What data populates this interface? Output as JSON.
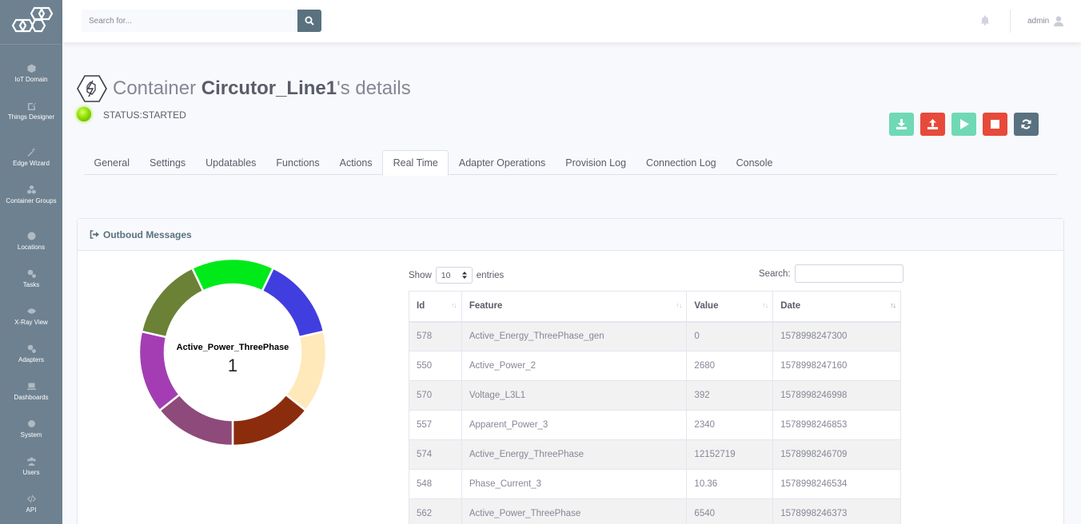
{
  "sidebar": {
    "logo_icon": "hexagon-logo-icon",
    "items": [
      {
        "label": "IoT Domain",
        "icon": "cube-icon"
      },
      {
        "label": "Things Designer",
        "icon": "edit-icon"
      },
      {
        "label": "Edge Wizard",
        "icon": "wand-icon"
      },
      {
        "label": "Container Groups",
        "icon": "cubes-icon"
      },
      {
        "label": "Locations",
        "icon": "globe-icon"
      },
      {
        "label": "Tasks",
        "icon": "cogs-icon"
      },
      {
        "label": "X-Ray View",
        "icon": "eye-icon"
      },
      {
        "label": "Adapters",
        "icon": "cogs-icon"
      },
      {
        "label": "Dashboards",
        "icon": "laptop-icon"
      },
      {
        "label": "System",
        "icon": "gear-icon"
      },
      {
        "label": "Users",
        "icon": "users-icon"
      },
      {
        "label": "API",
        "icon": "code-icon"
      }
    ]
  },
  "topbar": {
    "search_placeholder": "Search for...",
    "search_icon": "search-icon",
    "bell_icon": "bell-icon",
    "user_name": "admin",
    "user_icon": "user-icon"
  },
  "header": {
    "title_prefix": "Container ",
    "container_name": "Circutor_Line1",
    "title_suffix": "'s details",
    "status": "STATUS:STARTED",
    "status_color": "#8fe000"
  },
  "actions": [
    {
      "name": "download-button",
      "icon": "download-icon",
      "color": "#6fd9b5"
    },
    {
      "name": "upload-button",
      "icon": "upload-icon",
      "color": "#e74a3b"
    },
    {
      "name": "start-button",
      "icon": "play-icon",
      "color": "#6fd9b5"
    },
    {
      "name": "stop-button",
      "icon": "stop-icon",
      "color": "#e74a3b"
    },
    {
      "name": "refresh-button",
      "icon": "refresh-icon",
      "color": "#5a7180"
    }
  ],
  "tabs": [
    "General",
    "Settings",
    "Updatables",
    "Functions",
    "Actions",
    "Real Time",
    "Adapter Operations",
    "Provision Log",
    "Connection Log",
    "Console"
  ],
  "active_tab": "Real Time",
  "card": {
    "title": "Outboud Messages",
    "title_icon": "sign-out-icon"
  },
  "donut": {
    "center_label": "Active_Power_ThreePhase",
    "center_value": "1",
    "segments": [
      {
        "color": "#00ea1a",
        "value": 1
      },
      {
        "color": "#413ee0",
        "value": 1
      },
      {
        "color": "#ffe9bb",
        "value": 1
      },
      {
        "color": "#8b2c0c",
        "value": 1
      },
      {
        "color": "#8d4a7a",
        "value": 1
      },
      {
        "color": "#a43db4",
        "value": 1
      },
      {
        "color": "#6b8136",
        "value": 1
      }
    ]
  },
  "datatable": {
    "show_label": "Show",
    "entries_value": "10",
    "entries_label": "entries",
    "search_label": "Search:",
    "columns": [
      "Id",
      "Feature",
      "Value",
      "Date"
    ],
    "rows": [
      [
        "578",
        "Active_Energy_ThreePhase_gen",
        "0",
        "1578998247300"
      ],
      [
        "550",
        "Active_Power_2",
        "2680",
        "1578998247160"
      ],
      [
        "570",
        "Voltage_L3L1",
        "392",
        "1578998246998"
      ],
      [
        "557",
        "Apparent_Power_3",
        "2340",
        "1578998246853"
      ],
      [
        "574",
        "Active_Energy_ThreePhase",
        "12152719",
        "1578998246709"
      ],
      [
        "548",
        "Phase_Current_3",
        "10.36",
        "1578998246534"
      ],
      [
        "562",
        "Active_Power_ThreePhase",
        "6540",
        "1578998246373"
      ]
    ]
  }
}
